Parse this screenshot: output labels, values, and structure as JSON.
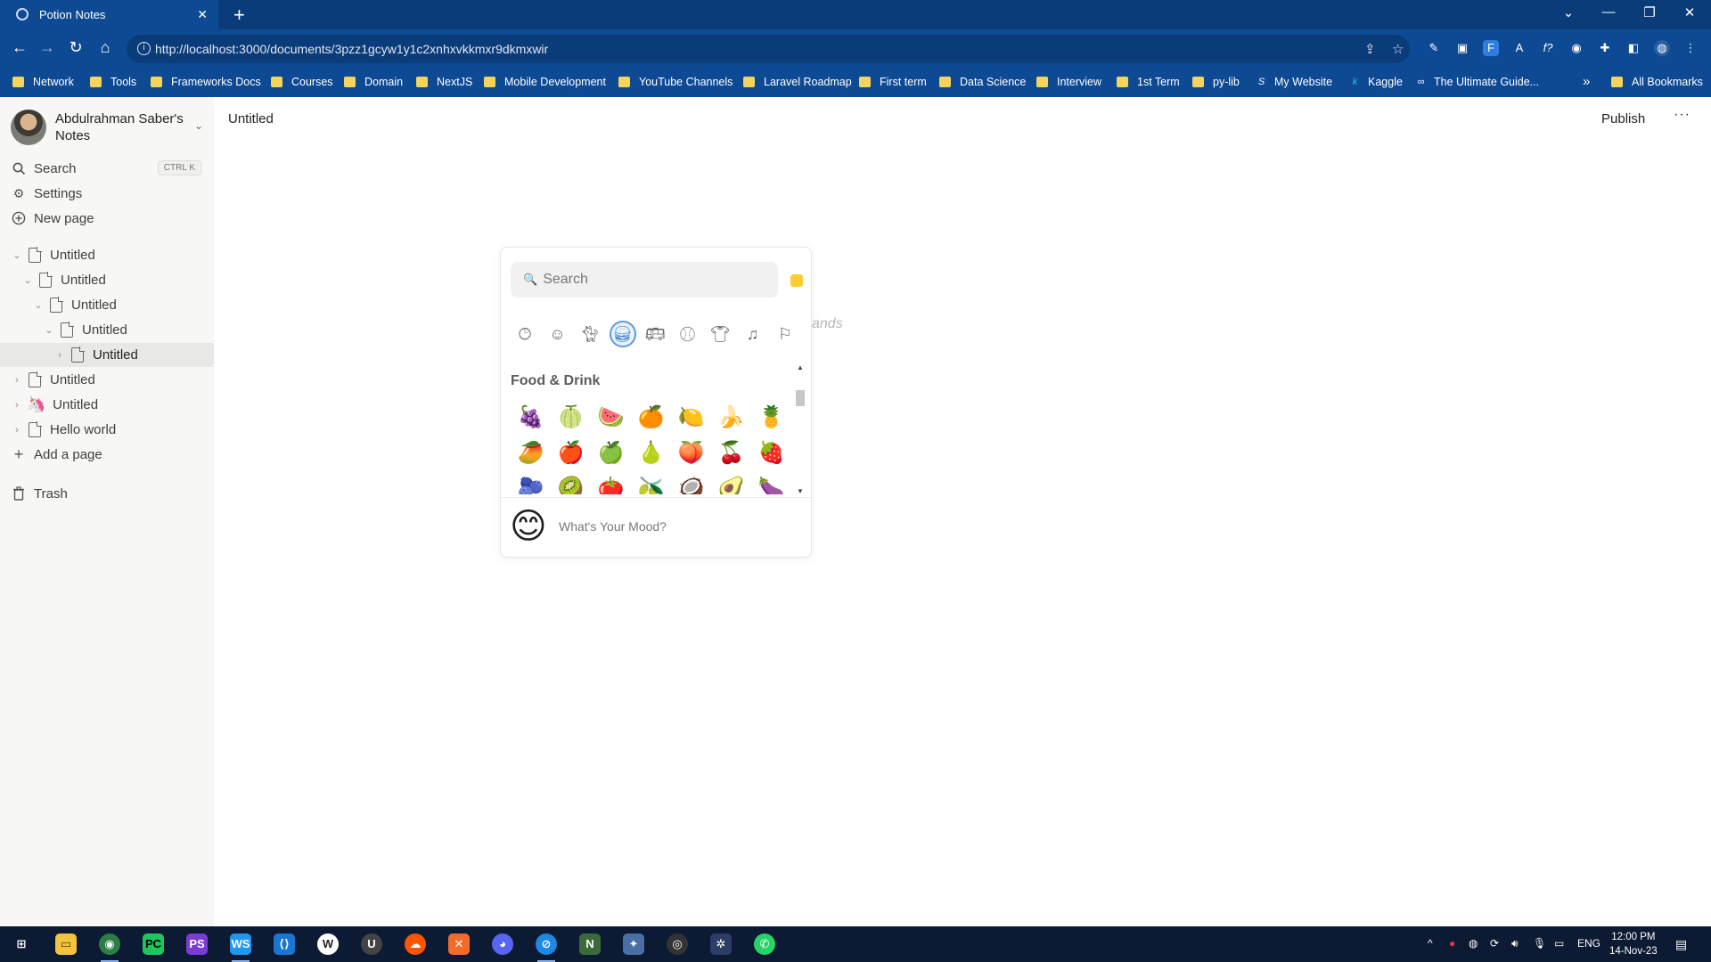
{
  "browser": {
    "tab_title": "Potion Notes",
    "tab_close": "✕",
    "new_tab": "+",
    "window_controls": [
      "⌄",
      "—",
      "❐",
      "✕"
    ],
    "url": "http://localhost:3000/documents/3pzz1gcyw1y1c2xnhxvkkmxr9dkmxwir",
    "nav": {
      "back": "←",
      "forward": "→",
      "reload": "↻",
      "home": "⌂"
    },
    "bookmarks": [
      {
        "label": "Network",
        "kind": "folder"
      },
      {
        "label": "Tools",
        "kind": "folder"
      },
      {
        "label": "Frameworks Docs",
        "kind": "folder"
      },
      {
        "label": "Courses",
        "kind": "folder"
      },
      {
        "label": "Domain",
        "kind": "folder"
      },
      {
        "label": "NextJS",
        "kind": "folder"
      },
      {
        "label": "Mobile Development",
        "kind": "folder"
      },
      {
        "label": "YouTube Channels",
        "kind": "folder"
      },
      {
        "label": "Laravel Roadmap",
        "kind": "folder"
      },
      {
        "label": "First term",
        "kind": "folder"
      },
      {
        "label": "Data Science",
        "kind": "folder"
      },
      {
        "label": "Interview",
        "kind": "folder"
      },
      {
        "label": "1st Term",
        "kind": "folder"
      },
      {
        "label": "py-lib",
        "kind": "folder"
      },
      {
        "label": "My Website",
        "kind": "site"
      },
      {
        "label": "Kaggle",
        "kind": "site"
      },
      {
        "label": "The Ultimate Guide...",
        "kind": "site"
      }
    ],
    "bookmarks_overflow": "»",
    "all_bookmarks": "All Bookmarks"
  },
  "sidebar": {
    "workspace_name": "Abdulrahman Saber's Notes",
    "search_label": "Search",
    "search_shortcut": "CTRL K",
    "settings_label": "Settings",
    "new_page_label": "New page",
    "documents": [
      {
        "label": "Untitled",
        "level": 0,
        "expanded": true
      },
      {
        "label": "Untitled",
        "level": 1,
        "expanded": true
      },
      {
        "label": "Untitled",
        "level": 2,
        "expanded": true
      },
      {
        "label": "Untitled",
        "level": 3,
        "expanded": true
      },
      {
        "label": "Untitled",
        "level": 4,
        "expanded": false,
        "active": true
      },
      {
        "label": "Untitled",
        "level": 0,
        "expanded": false
      },
      {
        "label": "Untitled",
        "level": 0,
        "expanded": false,
        "icon_emoji": "🦄"
      },
      {
        "label": "Hello world",
        "level": 0,
        "expanded": false
      }
    ],
    "add_page_label": "Add a page",
    "trash_label": "Trash"
  },
  "main": {
    "breadcrumb": "Untitled",
    "publish_label": "Publish",
    "more_label": "···",
    "ghost_text": "ands"
  },
  "emoji_picker": {
    "search_placeholder": "Search",
    "skin_tone_color": "#ffcd32",
    "category_icons": [
      "recent-icon",
      "smileys-icon",
      "animals-icon",
      "food-icon",
      "travel-icon",
      "activity-icon",
      "objects-icon",
      "symbols-icon",
      "flags-icon"
    ],
    "selected_category": "food-icon",
    "category_title": "Food & Drink",
    "emojis": [
      [
        "🍇",
        "🍈",
        "🍉",
        "🍊",
        "🍋",
        "🍌",
        "🍍"
      ],
      [
        "🥭",
        "🍎",
        "🍏",
        "🍐",
        "🍑",
        "🍒",
        "🍓"
      ],
      [
        "🫐",
        "🥝",
        "🍅",
        "🫒",
        "🥥",
        "🥑",
        "🍆"
      ]
    ],
    "mood_emoji": "😊",
    "mood_prompt": "What's Your Mood?"
  },
  "taskbar": {
    "clock_time": "12:00 PM",
    "clock_date": "14-Nov-23",
    "language": "ENG"
  }
}
